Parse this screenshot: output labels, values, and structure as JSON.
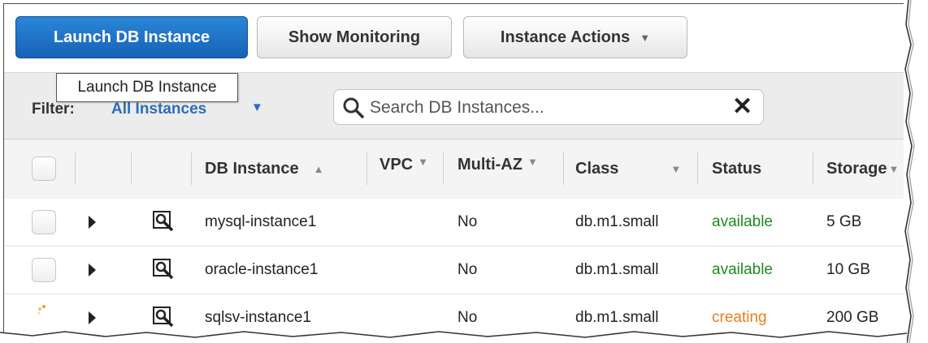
{
  "toolbar": {
    "launch_label": "Launch DB Instance",
    "monitor_label": "Show Monitoring",
    "actions_label": "Instance Actions",
    "actions_chevron": "▼"
  },
  "tooltip": {
    "text": "Launch DB Instance"
  },
  "filter": {
    "label": "Filter:",
    "value": "All Instances",
    "chevron": "▼"
  },
  "search": {
    "placeholder": "Search DB Instances...",
    "clear": "✕"
  },
  "table": {
    "columns": [
      "DB Instance",
      "VPC",
      "Multi-AZ",
      "Class",
      "Status",
      "Storage"
    ],
    "sort_up": "▲",
    "sort_down": "▼",
    "rows": [
      {
        "name": "mysql-instance1",
        "vpc": "",
        "multi_az": "No",
        "class": "db.m1.small",
        "status": "available",
        "storage": "5 GB"
      },
      {
        "name": "oracle-instance1",
        "vpc": "",
        "multi_az": "No",
        "class": "db.m1.small",
        "status": "available",
        "storage": "10 GB"
      },
      {
        "name": "sqlsv-instance1",
        "vpc": "",
        "multi_az": "No",
        "class": "db.m1.small",
        "status": "creating",
        "storage": "200 GB"
      }
    ]
  },
  "colors": {
    "primary": "#1762b8",
    "available": "#1e8a1e",
    "creating": "#e87f1a",
    "link": "#2a6ebb"
  },
  "icons": [
    "search-icon",
    "close-icon",
    "chevron-down-icon",
    "expand-arrow-icon",
    "details-magnifier-icon",
    "loading-spinner-icon"
  ]
}
